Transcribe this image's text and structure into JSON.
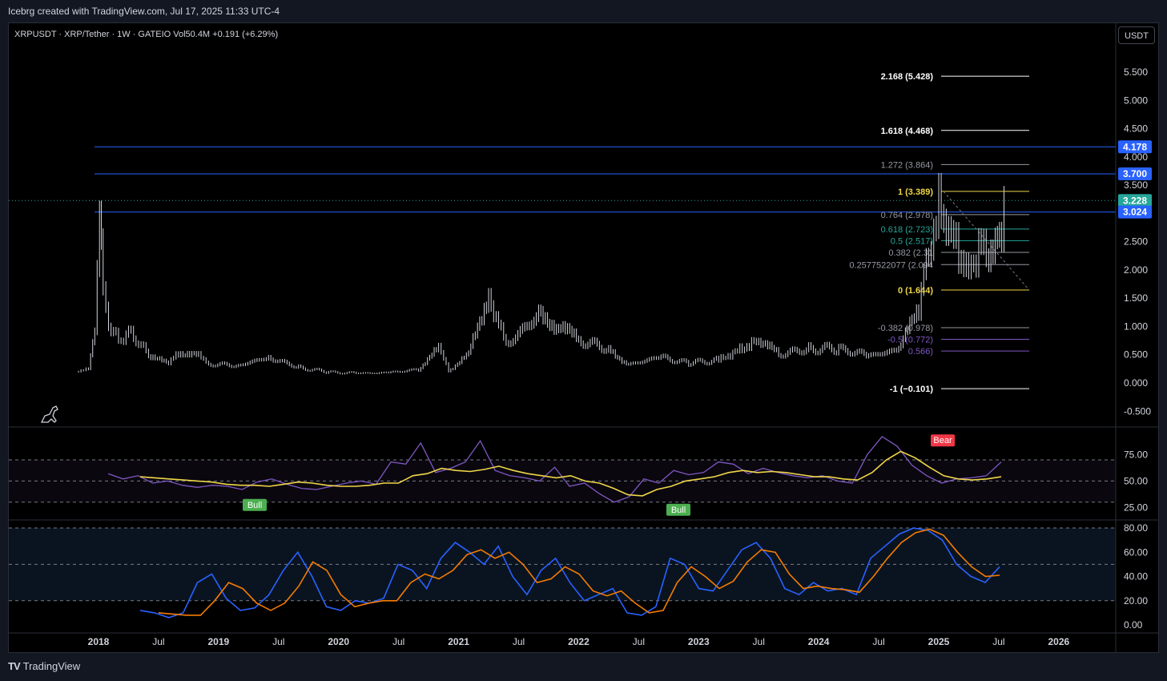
{
  "header": {
    "attribution": "Icebrg created with TradingView.com, Jul 17, 2025 11:33 UTC-4",
    "legend": "XRPUSDT · XRP/Tether · 1W · GATEIO  Vol50.4M  +0.191 (+6.29%)",
    "currency_button": "USDT"
  },
  "footer": {
    "brand": "TradingView",
    "logo": "TV"
  },
  "colors": {
    "background": "#000000",
    "page": "#131722",
    "blue_line": "#2962ff",
    "fib_yellow": "#f0d648",
    "fib_teal": "#26a69a",
    "rsi": "#7e57c2",
    "rsi_ma": "#f0d648",
    "stoch_k": "#2962ff",
    "stoch_d": "#f57c00",
    "bull": "#4caf50",
    "bear": "#f23645"
  },
  "chart_data": [
    {
      "type": "candlestick",
      "title": "XRPUSDT · XRP/Tether · 1W · GATEIO",
      "x_ticks": [
        "2018",
        "Jul",
        "2019",
        "Jul",
        "2020",
        "Jul",
        "2021",
        "Jul",
        "2022",
        "Jul",
        "2023",
        "Jul",
        "2024",
        "Jul",
        "2025",
        "Jul",
        "2026"
      ],
      "y_ticks": [
        "5.500",
        "5.000",
        "4.500",
        "4.000",
        "3.500",
        "3.000",
        "2.500",
        "2.000",
        "1.500",
        "1.000",
        "0.500",
        "0.000",
        "-0.500"
      ],
      "ylim": [
        -0.5,
        5.7
      ],
      "price_series": [
        [
          "2017-11",
          0.22
        ],
        [
          "2017-12",
          0.25
        ],
        [
          "2017-12-20",
          0.9
        ],
        [
          "2018-01-04",
          3.0
        ],
        [
          "2018-01-15",
          1.6
        ],
        [
          "2018-02",
          1.0
        ],
        [
          "2018-03",
          0.75
        ],
        [
          "2018-04",
          0.9
        ],
        [
          "2018-05",
          0.7
        ],
        [
          "2018-06",
          0.5
        ],
        [
          "2018-08",
          0.32
        ],
        [
          "2018-09",
          0.55
        ],
        [
          "2018-11",
          0.47
        ],
        [
          "2018-12",
          0.33
        ],
        [
          "2019-03",
          0.31
        ],
        [
          "2019-06",
          0.45
        ],
        [
          "2019-09",
          0.27
        ],
        [
          "2019-12",
          0.19
        ],
        [
          "2020-03",
          0.17
        ],
        [
          "2020-06",
          0.18
        ],
        [
          "2020-09",
          0.24
        ],
        [
          "2020-11",
          0.6
        ],
        [
          "2020-12",
          0.22
        ],
        [
          "2021-02",
          0.5
        ],
        [
          "2021-04",
          1.6
        ],
        [
          "2021-05",
          1.0
        ],
        [
          "2021-06",
          0.7
        ],
        [
          "2021-09",
          1.2
        ],
        [
          "2021-11",
          1.0
        ],
        [
          "2022-01",
          0.75
        ],
        [
          "2022-04",
          0.6
        ],
        [
          "2022-06",
          0.32
        ],
        [
          "2022-09",
          0.45
        ],
        [
          "2022-12",
          0.35
        ],
        [
          "2023-03",
          0.4
        ],
        [
          "2023-07",
          0.75
        ],
        [
          "2023-09",
          0.5
        ],
        [
          "2023-12",
          0.6
        ],
        [
          "2024-03",
          0.6
        ],
        [
          "2024-06",
          0.48
        ],
        [
          "2024-09",
          0.58
        ],
        [
          "2024-11",
          1.3
        ],
        [
          "2024-12",
          2.4
        ],
        [
          "2025-01",
          3.1
        ],
        [
          "2025-02",
          2.6
        ],
        [
          "2025-03",
          2.3
        ],
        [
          "2025-04",
          2.0
        ],
        [
          "2025-05",
          2.4
        ],
        [
          "2025-06",
          2.15
        ],
        [
          "2025-07-10",
          2.8
        ],
        [
          "2025-07-17",
          3.228
        ]
      ],
      "horizontal_lines": [
        4.178,
        3.7,
        3.024
      ],
      "price_labels": [
        "4.178",
        "3.700",
        "3.228",
        "3.024"
      ],
      "last_price": 3.228,
      "fib_levels": [
        {
          "label": "2.168 (5.428)",
          "value": 5.428,
          "color": "#ffffff"
        },
        {
          "label": "1.618 (4.468)",
          "value": 4.468,
          "color": "#ffffff"
        },
        {
          "label": "1.272 (3.864)",
          "value": 3.864,
          "color": "#9598a1"
        },
        {
          "label": "1 (3.389)",
          "value": 3.389,
          "color": "#f0d648"
        },
        {
          "label": "0.764 (2.978)",
          "value": 2.978,
          "color": "#9598a1"
        },
        {
          "label": "0.618 (2.723)",
          "value": 2.723,
          "color": "#26a69a"
        },
        {
          "label": "0.5 (2.517)",
          "value": 2.517,
          "color": "#26a69a"
        },
        {
          "label": "0.382 (2.31",
          "value": 2.31,
          "color": "#9598a1"
        },
        {
          "label": "0.2577522077 (2.094",
          "value": 2.094,
          "color": "#9598a1"
        },
        {
          "label": "0 (1.644)",
          "value": 1.644,
          "color": "#f0d648"
        },
        {
          "label": "-0.382 (0.978)",
          "value": 0.978,
          "color": "#9598a1"
        },
        {
          "label": "-0.5 (0.772)",
          "value": 0.772,
          "color": "#7e57c2"
        },
        {
          "label": "0.566)",
          "value": 0.566,
          "color": "#7e57c2"
        },
        {
          "label": "-1 (−0.101)",
          "value": -0.101,
          "color": "#ffffff"
        }
      ]
    },
    {
      "type": "line",
      "name": "RSI",
      "y_ticks": [
        "75.00",
        "50.00",
        "25.00"
      ],
      "ylim": [
        20,
        95
      ],
      "bands": [
        70,
        50,
        30
      ],
      "series": [
        {
          "values": [
            57,
            52,
            55,
            48,
            50,
            46,
            44,
            46,
            45,
            42,
            49,
            52,
            47,
            43,
            42,
            45,
            48,
            50,
            47,
            68,
            66,
            86,
            58,
            62,
            68,
            88,
            60,
            55,
            53,
            50,
            63,
            45,
            48,
            38,
            30,
            35,
            52,
            48,
            60,
            56,
            58,
            68,
            66,
            57,
            62,
            58,
            55,
            53,
            55,
            50,
            48,
            75,
            92,
            83,
            65,
            55,
            48,
            52,
            53,
            55,
            68
          ]
        },
        {
          "values": [
            54,
            53,
            52,
            51,
            50,
            49,
            47,
            46,
            46,
            45,
            47,
            49,
            48,
            46,
            45,
            45,
            46,
            48,
            48,
            55,
            57,
            62,
            60,
            59,
            61,
            64,
            60,
            57,
            55,
            53,
            55,
            50,
            48,
            43,
            37,
            36,
            42,
            45,
            50,
            52,
            54,
            58,
            60,
            58,
            59,
            58,
            56,
            54,
            54,
            52,
            51,
            58,
            70,
            78,
            72,
            63,
            55,
            52,
            51,
            52,
            54
          ]
        }
      ],
      "markers": [
        {
          "label": "Bull"
        },
        {
          "label": "Bull"
        },
        {
          "label": "Bear"
        }
      ]
    },
    {
      "type": "line",
      "name": "Stoch RSI",
      "y_ticks": [
        "80.00",
        "60.00",
        "40.00",
        "20.00",
        "0.00"
      ],
      "ylim": [
        -5,
        85
      ],
      "bands": [
        80,
        50,
        20
      ],
      "series": [
        {
          "values": [
            12,
            10,
            6,
            10,
            35,
            42,
            22,
            12,
            14,
            25,
            45,
            60,
            40,
            15,
            12,
            20,
            18,
            22,
            50,
            45,
            30,
            55,
            68,
            60,
            50,
            65,
            40,
            25,
            45,
            55,
            35,
            20,
            25,
            30,
            10,
            8,
            15,
            55,
            50,
            30,
            28,
            45,
            62,
            68,
            55,
            30,
            25,
            35,
            28,
            30,
            25,
            55,
            65,
            75,
            80,
            78,
            70,
            50,
            40,
            35,
            48
          ]
        },
        {
          "values": [
            10,
            9,
            8,
            8,
            20,
            35,
            30,
            18,
            12,
            18,
            32,
            52,
            45,
            25,
            15,
            18,
            20,
            20,
            35,
            42,
            38,
            45,
            58,
            62,
            55,
            60,
            50,
            35,
            38,
            48,
            42,
            28,
            24,
            28,
            18,
            10,
            12,
            35,
            48,
            40,
            30,
            36,
            52,
            62,
            60,
            42,
            30,
            32,
            30,
            29,
            27,
            40,
            55,
            68,
            76,
            79,
            74,
            60,
            48,
            40,
            41
          ]
        }
      ]
    }
  ]
}
